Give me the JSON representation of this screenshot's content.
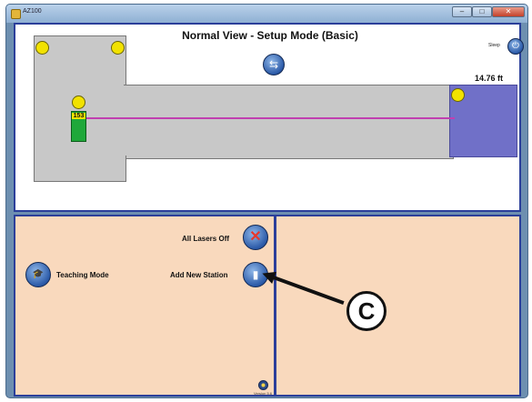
{
  "window": {
    "title": "AZ100",
    "controls": {
      "minimize": "–",
      "maximize": "□",
      "close": "✕"
    }
  },
  "view": {
    "title": "Normal View - Setup Mode (Basic)",
    "distance": "14.76 ft",
    "station_id": "153",
    "power_label": "Sleep",
    "swap_icon": "swap-arrows-icon",
    "power_icon": "power-icon"
  },
  "controls": {
    "all_lasers_off": "All Lasers Off",
    "teaching_mode": "Teaching Mode",
    "add_new_station": "Add New Station",
    "version_label": "Version 5.6"
  },
  "callout": {
    "letter": "C"
  },
  "colors": {
    "frame_blue": "#2b3f9a",
    "floor_gray": "#c8c8c8",
    "target_blue": "#7070c8",
    "sensor_yellow": "#f2e200",
    "station_green": "#1fa83a",
    "laser_magenta": "#c040b0",
    "control_peach": "#f9d9bd"
  }
}
